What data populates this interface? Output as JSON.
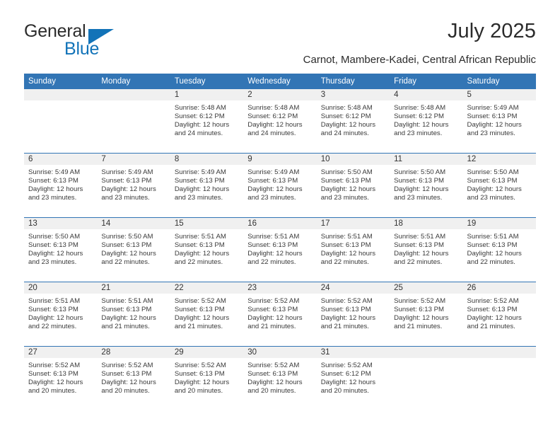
{
  "brand": {
    "word1": "General",
    "word2": "Blue",
    "accent_color": "#1273b8",
    "triangle_icon": "triangle-logo-icon"
  },
  "header": {
    "title": "July 2025",
    "subtitle": "Carnot, Mambere-Kadei, Central African Republic"
  },
  "theme": {
    "header_blue": "#3275b5",
    "daynum_band": "#f0f0f0",
    "text": "#3a3a3a"
  },
  "calendar": {
    "weekday_headers": [
      "Sunday",
      "Monday",
      "Tuesday",
      "Wednesday",
      "Thursday",
      "Friday",
      "Saturday"
    ],
    "weeks": [
      [
        {
          "day": "",
          "lines": []
        },
        {
          "day": "",
          "lines": []
        },
        {
          "day": "1",
          "lines": [
            "Sunrise: 5:48 AM",
            "Sunset: 6:12 PM",
            "Daylight: 12 hours",
            "and 24 minutes."
          ]
        },
        {
          "day": "2",
          "lines": [
            "Sunrise: 5:48 AM",
            "Sunset: 6:12 PM",
            "Daylight: 12 hours",
            "and 24 minutes."
          ]
        },
        {
          "day": "3",
          "lines": [
            "Sunrise: 5:48 AM",
            "Sunset: 6:12 PM",
            "Daylight: 12 hours",
            "and 24 minutes."
          ]
        },
        {
          "day": "4",
          "lines": [
            "Sunrise: 5:48 AM",
            "Sunset: 6:12 PM",
            "Daylight: 12 hours",
            "and 23 minutes."
          ]
        },
        {
          "day": "5",
          "lines": [
            "Sunrise: 5:49 AM",
            "Sunset: 6:13 PM",
            "Daylight: 12 hours",
            "and 23 minutes."
          ]
        }
      ],
      [
        {
          "day": "6",
          "lines": [
            "Sunrise: 5:49 AM",
            "Sunset: 6:13 PM",
            "Daylight: 12 hours",
            "and 23 minutes."
          ]
        },
        {
          "day": "7",
          "lines": [
            "Sunrise: 5:49 AM",
            "Sunset: 6:13 PM",
            "Daylight: 12 hours",
            "and 23 minutes."
          ]
        },
        {
          "day": "8",
          "lines": [
            "Sunrise: 5:49 AM",
            "Sunset: 6:13 PM",
            "Daylight: 12 hours",
            "and 23 minutes."
          ]
        },
        {
          "day": "9",
          "lines": [
            "Sunrise: 5:49 AM",
            "Sunset: 6:13 PM",
            "Daylight: 12 hours",
            "and 23 minutes."
          ]
        },
        {
          "day": "10",
          "lines": [
            "Sunrise: 5:50 AM",
            "Sunset: 6:13 PM",
            "Daylight: 12 hours",
            "and 23 minutes."
          ]
        },
        {
          "day": "11",
          "lines": [
            "Sunrise: 5:50 AM",
            "Sunset: 6:13 PM",
            "Daylight: 12 hours",
            "and 23 minutes."
          ]
        },
        {
          "day": "12",
          "lines": [
            "Sunrise: 5:50 AM",
            "Sunset: 6:13 PM",
            "Daylight: 12 hours",
            "and 23 minutes."
          ]
        }
      ],
      [
        {
          "day": "13",
          "lines": [
            "Sunrise: 5:50 AM",
            "Sunset: 6:13 PM",
            "Daylight: 12 hours",
            "and 23 minutes."
          ]
        },
        {
          "day": "14",
          "lines": [
            "Sunrise: 5:50 AM",
            "Sunset: 6:13 PM",
            "Daylight: 12 hours",
            "and 22 minutes."
          ]
        },
        {
          "day": "15",
          "lines": [
            "Sunrise: 5:51 AM",
            "Sunset: 6:13 PM",
            "Daylight: 12 hours",
            "and 22 minutes."
          ]
        },
        {
          "day": "16",
          "lines": [
            "Sunrise: 5:51 AM",
            "Sunset: 6:13 PM",
            "Daylight: 12 hours",
            "and 22 minutes."
          ]
        },
        {
          "day": "17",
          "lines": [
            "Sunrise: 5:51 AM",
            "Sunset: 6:13 PM",
            "Daylight: 12 hours",
            "and 22 minutes."
          ]
        },
        {
          "day": "18",
          "lines": [
            "Sunrise: 5:51 AM",
            "Sunset: 6:13 PM",
            "Daylight: 12 hours",
            "and 22 minutes."
          ]
        },
        {
          "day": "19",
          "lines": [
            "Sunrise: 5:51 AM",
            "Sunset: 6:13 PM",
            "Daylight: 12 hours",
            "and 22 minutes."
          ]
        }
      ],
      [
        {
          "day": "20",
          "lines": [
            "Sunrise: 5:51 AM",
            "Sunset: 6:13 PM",
            "Daylight: 12 hours",
            "and 22 minutes."
          ]
        },
        {
          "day": "21",
          "lines": [
            "Sunrise: 5:51 AM",
            "Sunset: 6:13 PM",
            "Daylight: 12 hours",
            "and 21 minutes."
          ]
        },
        {
          "day": "22",
          "lines": [
            "Sunrise: 5:52 AM",
            "Sunset: 6:13 PM",
            "Daylight: 12 hours",
            "and 21 minutes."
          ]
        },
        {
          "day": "23",
          "lines": [
            "Sunrise: 5:52 AM",
            "Sunset: 6:13 PM",
            "Daylight: 12 hours",
            "and 21 minutes."
          ]
        },
        {
          "day": "24",
          "lines": [
            "Sunrise: 5:52 AM",
            "Sunset: 6:13 PM",
            "Daylight: 12 hours",
            "and 21 minutes."
          ]
        },
        {
          "day": "25",
          "lines": [
            "Sunrise: 5:52 AM",
            "Sunset: 6:13 PM",
            "Daylight: 12 hours",
            "and 21 minutes."
          ]
        },
        {
          "day": "26",
          "lines": [
            "Sunrise: 5:52 AM",
            "Sunset: 6:13 PM",
            "Daylight: 12 hours",
            "and 21 minutes."
          ]
        }
      ],
      [
        {
          "day": "27",
          "lines": [
            "Sunrise: 5:52 AM",
            "Sunset: 6:13 PM",
            "Daylight: 12 hours",
            "and 20 minutes."
          ]
        },
        {
          "day": "28",
          "lines": [
            "Sunrise: 5:52 AM",
            "Sunset: 6:13 PM",
            "Daylight: 12 hours",
            "and 20 minutes."
          ]
        },
        {
          "day": "29",
          "lines": [
            "Sunrise: 5:52 AM",
            "Sunset: 6:13 PM",
            "Daylight: 12 hours",
            "and 20 minutes."
          ]
        },
        {
          "day": "30",
          "lines": [
            "Sunrise: 5:52 AM",
            "Sunset: 6:13 PM",
            "Daylight: 12 hours",
            "and 20 minutes."
          ]
        },
        {
          "day": "31",
          "lines": [
            "Sunrise: 5:52 AM",
            "Sunset: 6:12 PM",
            "Daylight: 12 hours",
            "and 20 minutes."
          ]
        },
        {
          "day": "",
          "lines": []
        },
        {
          "day": "",
          "lines": []
        }
      ]
    ]
  }
}
